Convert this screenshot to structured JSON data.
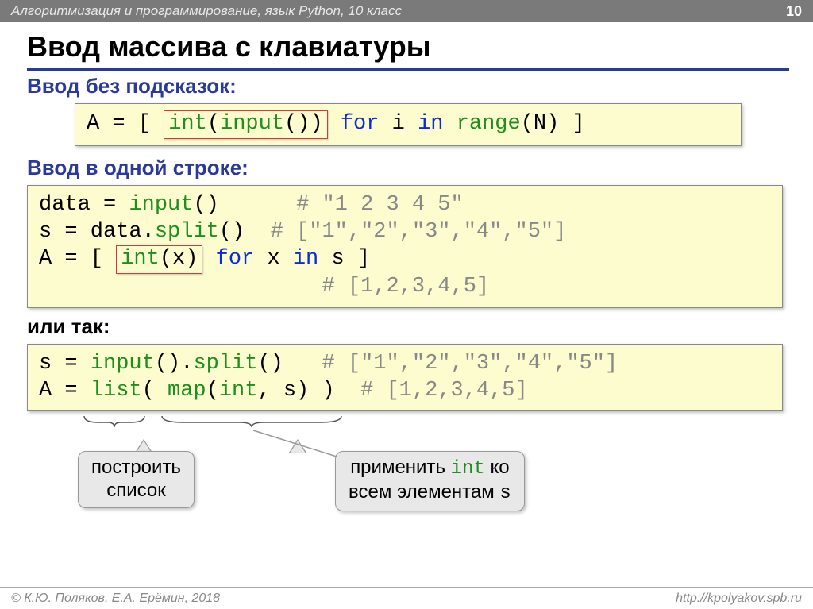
{
  "header": {
    "course": "Алгоритмизация и программирование, язык Python, 10 класс",
    "page": "10"
  },
  "title": "Ввод массива с клавиатуры",
  "section1": {
    "heading": "Ввод без подсказок:",
    "code": {
      "t1": "A = [ ",
      "boxed": "int(input())",
      "t2": " for i in range(N) ]",
      "kw_for": "for",
      "kw_in": "in",
      "fn_range": "range",
      "fn_int": "int",
      "fn_input": "input"
    }
  },
  "section2": {
    "heading": "Ввод в одной строке:",
    "line1_a": "data = ",
    "line1_fn": "input",
    "line1_b": "()",
    "line1_cmt": "# \"1 2 3 4 5\"",
    "line2_a": "s = data.",
    "line2_fn": "split",
    "line2_b": "()",
    "line2_cmt": "# [\"1\",\"2\",\"3\",\"4\",\"5\"]",
    "line3_a": "A = [ ",
    "line3_box_fn": "int",
    "line3_box_b": "(x)",
    "line3_c": " for x in s ]",
    "line3_kw_for": "for",
    "line3_kw_in": "in",
    "line4_cmt": "# [1,2,3,4,5]"
  },
  "or_label": "или так:",
  "section3": {
    "line1_a": "s = ",
    "line1_fn1": "input",
    "line1_b": "().",
    "line1_fn2": "split",
    "line1_c": "()",
    "line1_cmt": "# [\"1\",\"2\",\"3\",\"4\",\"5\"]",
    "line2_a": "A = ",
    "line2_fn1": "list",
    "line2_b": "( ",
    "line2_fn2": "map",
    "line2_c": "(",
    "line2_fn3": "int",
    "line2_d": ", s) )",
    "line2_cmt": "# [1,2,3,4,5]"
  },
  "callout1": {
    "l1": "построить",
    "l2": "список"
  },
  "callout2": {
    "l1a": "применить ",
    "l1b": "int",
    "l1c": " ко",
    "l2a": "всем элементам ",
    "l2b": "s"
  },
  "footer": {
    "left": "© К.Ю. Поляков, Е.А. Ерёмин, 2018",
    "right": "http://kpolyakov.spb.ru"
  }
}
